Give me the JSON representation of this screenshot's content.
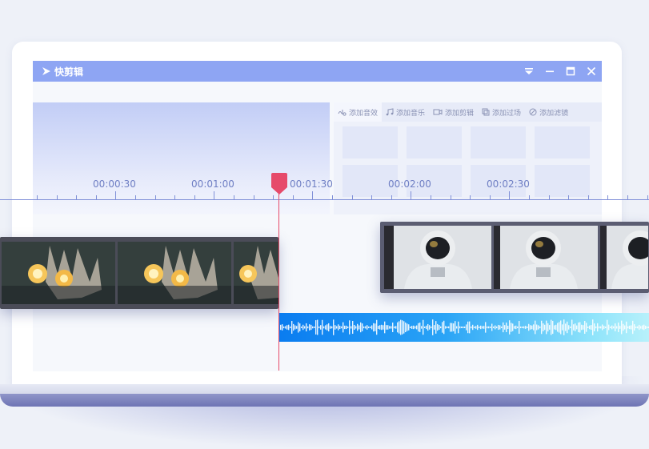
{
  "app": {
    "title": "快剪辑"
  },
  "window_controls": [
    {
      "name": "dropdown-menu-icon",
      "glyph": "▾"
    },
    {
      "name": "minimize-icon",
      "glyph": "—"
    },
    {
      "name": "maximize-icon",
      "glyph": "☐"
    },
    {
      "name": "close-icon",
      "glyph": "✕"
    }
  ],
  "asset_tabs": [
    {
      "name": "add-sound-effect",
      "label": "添加音效",
      "icon": "sound-effect-icon"
    },
    {
      "name": "add-music",
      "label": "添加音乐",
      "icon": "music-note-icon"
    },
    {
      "name": "add-clip",
      "label": "添加剪辑",
      "icon": "video-camera-icon"
    },
    {
      "name": "add-transition",
      "label": "添加过场",
      "icon": "transition-icon"
    },
    {
      "name": "add-filter",
      "label": "添加滤镜",
      "icon": "filter-icon"
    }
  ],
  "timeline": {
    "ruler_labels": [
      "00:00:30",
      "00:01:00",
      "00:01:30",
      "00:02:00",
      "00:02:30"
    ],
    "playhead_time": "00:01:20"
  },
  "tracks": {
    "video_clip_1": "light-bulbs-footage",
    "video_clip_2": "astronaut-suit-footage",
    "audio_clip": "audio-waveform"
  },
  "colors": {
    "titlebar": "#8ea5f3",
    "playhead": "#e64a6a",
    "audio_start": "#0a7cf0",
    "audio_end": "#b8f1fb"
  }
}
